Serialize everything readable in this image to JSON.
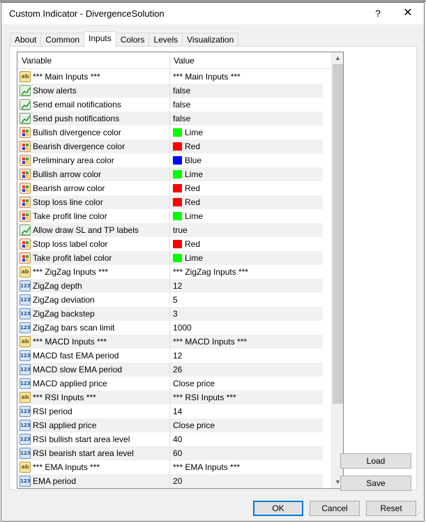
{
  "window": {
    "title": "Custom Indicator - DivergenceSolution",
    "help": "?",
    "close": "✕"
  },
  "tabs": [
    {
      "label": "About",
      "active": false
    },
    {
      "label": "Common",
      "active": false
    },
    {
      "label": "Inputs",
      "active": true
    },
    {
      "label": "Colors",
      "active": false
    },
    {
      "label": "Levels",
      "active": false
    },
    {
      "label": "Visualization",
      "active": false
    }
  ],
  "grid": {
    "headers": {
      "variable": "Variable",
      "value": "Value"
    },
    "rows": [
      {
        "type": "string",
        "icon": "ab-string-icon",
        "icon_text": "ab",
        "name": "*** Main Inputs ***",
        "value": "*** Main Inputs ***"
      },
      {
        "type": "bool",
        "icon": "bool-checkmark-icon",
        "name": "Show alerts",
        "value": "false"
      },
      {
        "type": "bool",
        "icon": "bool-checkmark-icon",
        "name": "Send email notifications",
        "value": "false"
      },
      {
        "type": "bool",
        "icon": "bool-checkmark-icon",
        "name": "Send push notifications",
        "value": "false"
      },
      {
        "type": "color",
        "icon": "color-palette-icon",
        "name": "Bullish divergence color",
        "value": "Lime",
        "swatch": "#00ff00"
      },
      {
        "type": "color",
        "icon": "color-palette-icon",
        "name": "Bearish divergence color",
        "value": "Red",
        "swatch": "#ff0000"
      },
      {
        "type": "color",
        "icon": "color-palette-icon",
        "name": "Preliminary area color",
        "value": "Blue",
        "swatch": "#0000ff"
      },
      {
        "type": "color",
        "icon": "color-palette-icon",
        "name": "Bullish arrow color",
        "value": "Lime",
        "swatch": "#00ff00"
      },
      {
        "type": "color",
        "icon": "color-palette-icon",
        "name": "Bearish arrow color",
        "value": "Red",
        "swatch": "#ff0000"
      },
      {
        "type": "color",
        "icon": "color-palette-icon",
        "name": "Stop loss line color",
        "value": "Red",
        "swatch": "#ff0000"
      },
      {
        "type": "color",
        "icon": "color-palette-icon",
        "name": "Take profit line color",
        "value": "Lime",
        "swatch": "#00ff00"
      },
      {
        "type": "bool",
        "icon": "bool-checkmark-icon",
        "name": "Allow draw SL and TP labels",
        "value": "true"
      },
      {
        "type": "color",
        "icon": "color-palette-icon",
        "name": "Stop loss label color",
        "value": "Red",
        "swatch": "#ff0000"
      },
      {
        "type": "color",
        "icon": "color-palette-icon",
        "name": "Take profit label color",
        "value": "Lime",
        "swatch": "#00ff00"
      },
      {
        "type": "string",
        "icon": "ab-string-icon",
        "icon_text": "ab",
        "name": "*** ZigZag Inputs ***",
        "value": "*** ZigZag Inputs ***"
      },
      {
        "type": "int",
        "icon": "integer-123-icon",
        "icon_text": "123",
        "name": "ZigZag depth",
        "value": "12"
      },
      {
        "type": "int",
        "icon": "integer-123-icon",
        "icon_text": "123",
        "name": "ZigZag deviation",
        "value": "5"
      },
      {
        "type": "int",
        "icon": "integer-123-icon",
        "icon_text": "123",
        "name": "ZigZag backstep",
        "value": "3"
      },
      {
        "type": "int",
        "icon": "integer-123-icon",
        "icon_text": "123",
        "name": "ZigZag bars scan limit",
        "value": "1000"
      },
      {
        "type": "string",
        "icon": "ab-string-icon",
        "icon_text": "ab",
        "name": "*** MACD Inputs ***",
        "value": "*** MACD Inputs ***"
      },
      {
        "type": "int",
        "icon": "integer-123-icon",
        "icon_text": "123",
        "name": "MACD fast EMA period",
        "value": "12"
      },
      {
        "type": "int",
        "icon": "integer-123-icon",
        "icon_text": "123",
        "name": "MACD slow EMA period",
        "value": "26"
      },
      {
        "type": "int",
        "icon": "integer-123-icon",
        "icon_text": "123",
        "name": "MACD applied price",
        "value": "Close price"
      },
      {
        "type": "string",
        "icon": "ab-string-icon",
        "icon_text": "ab",
        "name": "*** RSI Inputs ***",
        "value": "*** RSI Inputs ***"
      },
      {
        "type": "int",
        "icon": "integer-123-icon",
        "icon_text": "123",
        "name": "RSI period",
        "value": "14"
      },
      {
        "type": "int",
        "icon": "integer-123-icon",
        "icon_text": "123",
        "name": "RSI applied price",
        "value": "Close price"
      },
      {
        "type": "int",
        "icon": "integer-123-icon",
        "icon_text": "123",
        "name": "RSI bullish start area level",
        "value": "40"
      },
      {
        "type": "int",
        "icon": "integer-123-icon",
        "icon_text": "123",
        "name": "RSI bearish start area level",
        "value": "60"
      },
      {
        "type": "string",
        "icon": "ab-string-icon",
        "icon_text": "ab",
        "name": "*** EMA Inputs ***",
        "value": "*** EMA Inputs ***"
      },
      {
        "type": "int",
        "icon": "integer-123-icon",
        "icon_text": "123",
        "name": "EMA period",
        "value": "20"
      }
    ]
  },
  "scrollbar": {
    "up": "▲",
    "down": "▼"
  },
  "side_buttons": {
    "load": "Load",
    "save": "Save"
  },
  "footer": {
    "ok": "OK",
    "cancel": "Cancel",
    "reset": "Reset"
  }
}
